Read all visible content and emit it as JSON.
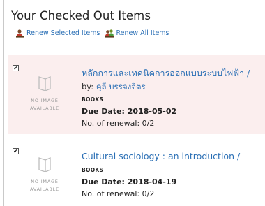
{
  "page": {
    "title": "Your Checked Out Items"
  },
  "actions": {
    "renew_selected": {
      "label": "Renew Selected Items",
      "icon": "renew-user-icon"
    },
    "renew_all": {
      "label": "Renew All Items",
      "icon": "renew-all-users-icon"
    }
  },
  "colors": {
    "link": "#2a6fb5",
    "highlight_row": "#fbeeee",
    "icon_gray": "#bdbdbd"
  },
  "placeholder": {
    "line1": "NO IMAGE",
    "line2": "AVAILABLE"
  },
  "items": [
    {
      "checked": true,
      "checkmark": "✔",
      "title": "หลักการและเทคนิคการออกแบบระบบไฟฟ้า /",
      "by_label": "by:",
      "author": "คุลี บรรจงจิตร",
      "format": "BOOKS",
      "due_label": "Due Date:",
      "due_date": "2018-05-02",
      "renewal_label": "No. of renewal:",
      "renewal": "0/2"
    },
    {
      "checked": true,
      "checkmark": "✔",
      "title": "Cultural sociology : an introduction /",
      "format": "BOOKS",
      "due_label": "Due Date:",
      "due_date": "2018-04-19",
      "renewal_label": "No. of renewal:",
      "renewal": "0/2"
    }
  ]
}
